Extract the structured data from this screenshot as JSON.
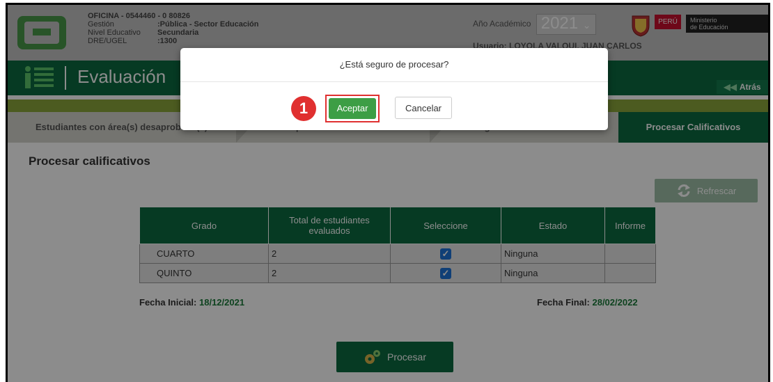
{
  "header": {
    "office_title": "OFICINA - 0544460 - 0  80826",
    "rows": [
      {
        "label": "Gestión",
        "value": ":Pública - Sector Educación"
      },
      {
        "label": "Nivel Educativo",
        "value": "Secundaria"
      },
      {
        "label": "DRE/UGEL",
        "value": ":1300"
      }
    ],
    "year_label": "Año Académico",
    "year_value": "2021",
    "user": "Usuario: LOYOLA VALQUI, JUAN CARLOS",
    "peru": "PERÚ",
    "ministry_line1": "Ministerio",
    "ministry_line2": "de Educación"
  },
  "titlebar": {
    "title": "Evaluación",
    "back_label": "Atrás"
  },
  "steps": {
    "step1": "Estudiantes con área(s) desaprobada(s)",
    "step2": "Responsable de Evaluación",
    "step3": "Registro de Calificativos",
    "step4": "Procesar Calificativos"
  },
  "main": {
    "heading": "Procesar calificativos",
    "refresh_label": "Refrescar",
    "table": {
      "headers": [
        "Grado",
        "Total de estudiantes evaluados",
        "Seleccione",
        "Estado",
        "Informe"
      ],
      "rows": [
        {
          "grado": "CUARTO",
          "total": "2",
          "selected": true,
          "estado": "Ninguna",
          "informe": ""
        },
        {
          "grado": "QUINTO",
          "total": "2",
          "selected": true,
          "estado": "Ninguna",
          "informe": ""
        }
      ]
    },
    "fecha_inicial_label": "Fecha Inicial:",
    "fecha_inicial": "18/12/2021",
    "fecha_final_label": "Fecha Final:",
    "fecha_final": "28/02/2022",
    "procesar_label": "Procesar"
  },
  "modal": {
    "question": "¿Está seguro de procesar?",
    "step_number": "1",
    "accept_label": "Aceptar",
    "cancel_label": "Cancelar"
  },
  "colors": {
    "brand_green": "#0b6a40",
    "accept_green": "#3d9e45",
    "highlight_red": "#e03030"
  }
}
